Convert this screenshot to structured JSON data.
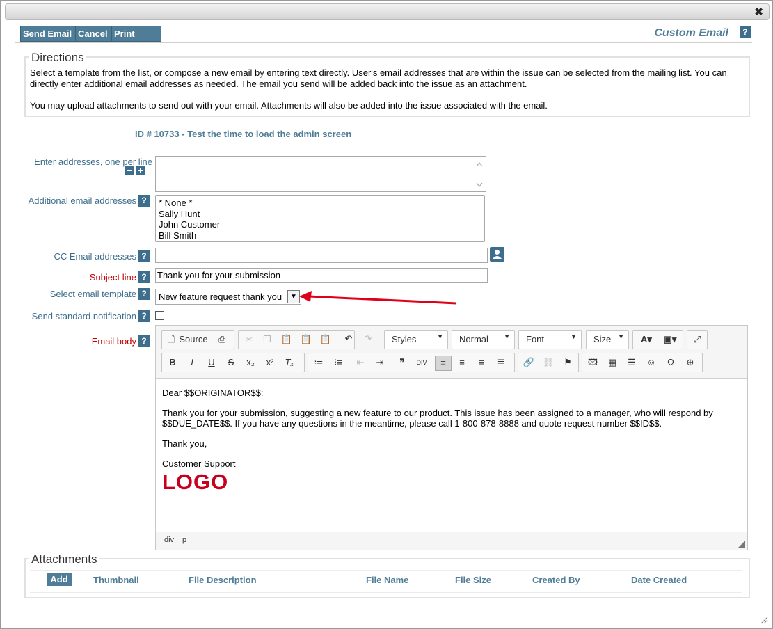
{
  "window": {
    "close_glyph": "✖"
  },
  "toolbar": {
    "send_email": "Send Email",
    "cancel": "Cancel",
    "print_page": "Print Page",
    "title": "Custom Email",
    "help": "?"
  },
  "directions": {
    "legend": "Directions",
    "line1": "Select a template from the list, or compose a new email by entering text directly. User's email addresses that are within the issue can be selected from the mailing list. You can directly enter additional email addresses as needed. The email you send will be added back into the issue as an attachment.",
    "line2": "You may upload attachments to send out with your email. Attachments will also be added into the issue associated with the email."
  },
  "issue": {
    "id_line": "ID # 10733  -  Test the time to load the admin screen"
  },
  "form": {
    "addresses_label": "Enter addresses, one per line",
    "additional_label": "Additional email addresses",
    "additional_options": [
      "* None *",
      "Sally Hunt",
      "John Customer",
      "Bill Smith"
    ],
    "cc_label": "CC Email addresses",
    "cc_value": "",
    "subject_label": "Subject line",
    "subject_value": "Thank you for your submission",
    "template_label": "Select email template",
    "template_value": "New feature request thank you",
    "notify_label": "Send standard notification",
    "notify_checked": false,
    "body_label": "Email body",
    "help": "?"
  },
  "editor": {
    "source_label": "Source",
    "styles": "Styles",
    "format": "Normal",
    "font": "Font",
    "size": "Size",
    "body_greeting": "Dear $$ORIGINATOR$$:",
    "body_line1": "Thank you for your submission, suggesting a new feature to our product.  This issue has been assigned to a manager, who will respond by",
    "body_line2": "$$DUE_DATE$$. If you have any questions in the meantime, please call 1-800-878-8888 and quote request number $$ID$$.",
    "body_thanks": "Thank you,",
    "body_signature": "Customer Support",
    "logo_text": "LOGO",
    "path_div": "div",
    "path_p": "p"
  },
  "attachments": {
    "legend": "Attachments",
    "add": "Add",
    "columns": [
      "Thumbnail",
      "File Description",
      "File Name",
      "File Size",
      "Created By",
      "Date Created"
    ]
  },
  "colors": {
    "accent": "#4f7d98",
    "required": "#c00000",
    "logo": "#c8001e",
    "arrow": "#e0001a"
  }
}
